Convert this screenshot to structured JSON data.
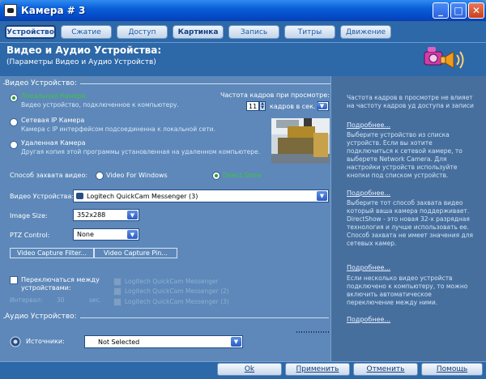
{
  "window": {
    "title": "Камера # 3"
  },
  "tabs": [
    {
      "label": "Устройство"
    },
    {
      "label": "Сжатие"
    },
    {
      "label": "Доступ"
    },
    {
      "label": "Картинка"
    },
    {
      "label": "Запись"
    },
    {
      "label": "Титры"
    },
    {
      "label": "Движение"
    }
  ],
  "header": {
    "title": "Видео и Аудио Устройства:",
    "subtitle": "(Параметры Видео и Аудио Устройств)"
  },
  "video": {
    "section_label": "Видео Устройство:",
    "options": [
      {
        "title": "Локальная Камера",
        "desc": "Видео устройство, подключенное к компьютеру."
      },
      {
        "title": "Сетевая IP Камера",
        "desc": "Камера с IP интерфейсом подсоединенна к локальной сети."
      },
      {
        "title": "Удаленная Камера",
        "desc": "Другая копия этой программы установленная на удаленном компьютере."
      }
    ],
    "fps_label": "Частота кадров при просмотре:",
    "fps_value": "11",
    "fps_unit": "кадров в сек.",
    "capture_label": "Способ захвата видео:",
    "capture_vfw": "Video For Windows",
    "capture_ds": "Direct Show",
    "device_label": "Видео Устройства:",
    "device_value": "Logitech QuickCam Messenger (3)",
    "image_size_label": "Image Size:",
    "image_size_value": "352x288",
    "ptz_label": "PTZ Control:",
    "ptz_value": "None",
    "btn_filter": "Video Capture Filter...",
    "btn_pin": "Video Capture Pin...",
    "switch_label": "Переключаться между устройствами:",
    "interval_label": "Интервал:",
    "interval_value": "30",
    "interval_unit": "sec.",
    "switch_devices": [
      "Logitech QuickCam Messenger",
      "Logitech QuickCam Messenger (2)",
      "Logitech QuickCam Messenger (3)"
    ]
  },
  "audio": {
    "section_label": "Аудио Устройство:",
    "source_label": "Источники:",
    "source_value": "Not Selected"
  },
  "help": {
    "p1": "Частота кадров в просмотре не влияет на частоту кадров уд доступа и записи",
    "more": "Подробнее...",
    "p2": "Выберите устройство из списка устройств. Если вы хотите подключиться к сетевой камере, то выберете Network Camera. Для настройки устройств используйте кнопки под списком устройств.",
    "p3": "Выберите тот способ захвата видео который ваша камера поддерживает. DirectShow - это новая 32-х разрядная технология и лучше использовать ее. Способ захвата не имеет значения для сетевых камер.",
    "p4": "Если несколько видео устройств подключено к компьютеру, то можно включить автоматическое переключение между ними."
  },
  "buttons": {
    "ok": "Ok",
    "apply": "Применить",
    "cancel": "Отменить",
    "help": "Помощь"
  },
  "colors": {
    "panel": "#5d88b9",
    "titlebar": "#0a5ed8",
    "selected_option": "#3cc83c"
  }
}
